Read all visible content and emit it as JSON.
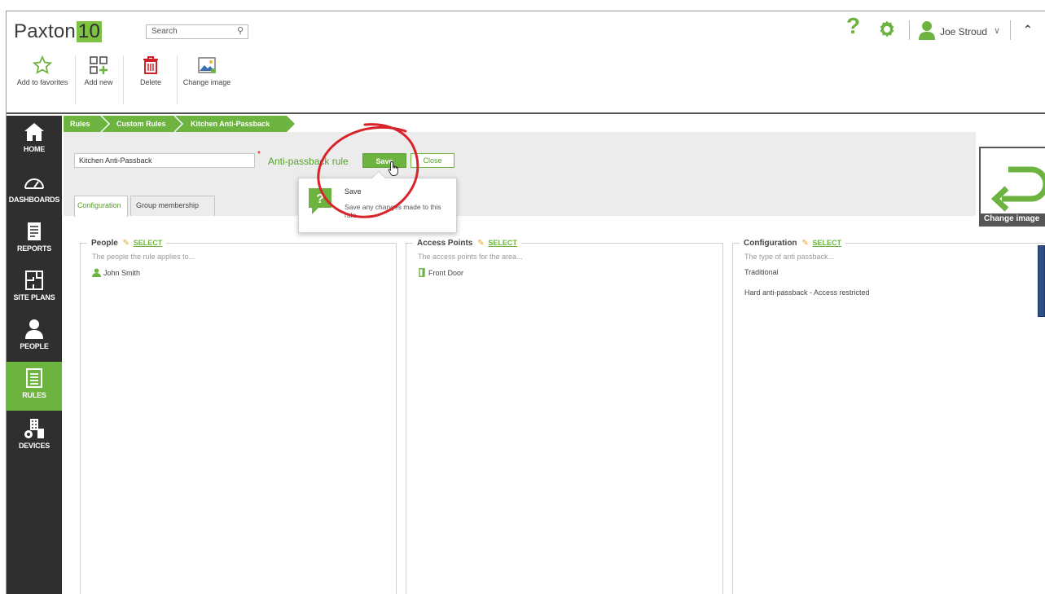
{
  "app": {
    "logo_text": "Paxton",
    "logo_version": "10"
  },
  "search": {
    "placeholder": "Search"
  },
  "header": {
    "help_icon": "help-question-icon",
    "settings_icon": "gear-icon",
    "user_name": "Joe Stroud",
    "user_chevron": "∨",
    "collapse_glyph": "^"
  },
  "toolbar": {
    "items": [
      {
        "label": "Add to favorites",
        "icon": "star-icon"
      },
      {
        "label": "Add new",
        "icon": "add-grid-icon"
      },
      {
        "label": "Delete",
        "icon": "trash-icon"
      },
      {
        "label": "Change image",
        "icon": "image-icon"
      }
    ]
  },
  "sidebar": {
    "items": [
      {
        "label": "HOME",
        "icon": "home-icon"
      },
      {
        "label": "DASHBOARDS",
        "icon": "gauge-icon"
      },
      {
        "label": "REPORTS",
        "icon": "report-icon"
      },
      {
        "label": "SITE PLANS",
        "icon": "floorplan-icon"
      },
      {
        "label": "PEOPLE",
        "icon": "person-icon"
      },
      {
        "label": "RULES",
        "icon": "rules-icon",
        "active": true
      },
      {
        "label": "DEVICES",
        "icon": "devices-icon"
      }
    ]
  },
  "breadcrumb": {
    "items": [
      "Rules",
      "Custom Rules",
      "Kitchen Anti-Passback"
    ]
  },
  "form": {
    "name_value": "Kitchen Anti-Passback",
    "required_mark": "*",
    "rule_type": "Anti-passback rule",
    "save_label": "Save",
    "close_label": "Close"
  },
  "tabs": [
    {
      "label": "Configuration",
      "active": true
    },
    {
      "label": "Group membership",
      "active": false
    }
  ],
  "change_image": {
    "label": "Change image"
  },
  "panels": {
    "people": {
      "title": "People",
      "select": "SELECT",
      "description": "The people the rule applies to...",
      "items": [
        "John Smith"
      ]
    },
    "access_points": {
      "title": "Access Points",
      "select": "SELECT",
      "description": "The access points for the area...",
      "items": [
        "Front Door"
      ]
    },
    "configuration": {
      "title": "Configuration",
      "select": "SELECT",
      "description": "The type of anti passback...",
      "items": [
        "Traditional",
        "Hard anti-passback - Access restricted"
      ]
    }
  },
  "tooltip": {
    "title": "Save",
    "text": "Save any changes made to this rule.",
    "icon": "help-question-icon"
  },
  "colors": {
    "brand_green": "#6cb33f",
    "sidebar_dark": "#2f2f2f",
    "annotation_red": "#d8232a"
  }
}
